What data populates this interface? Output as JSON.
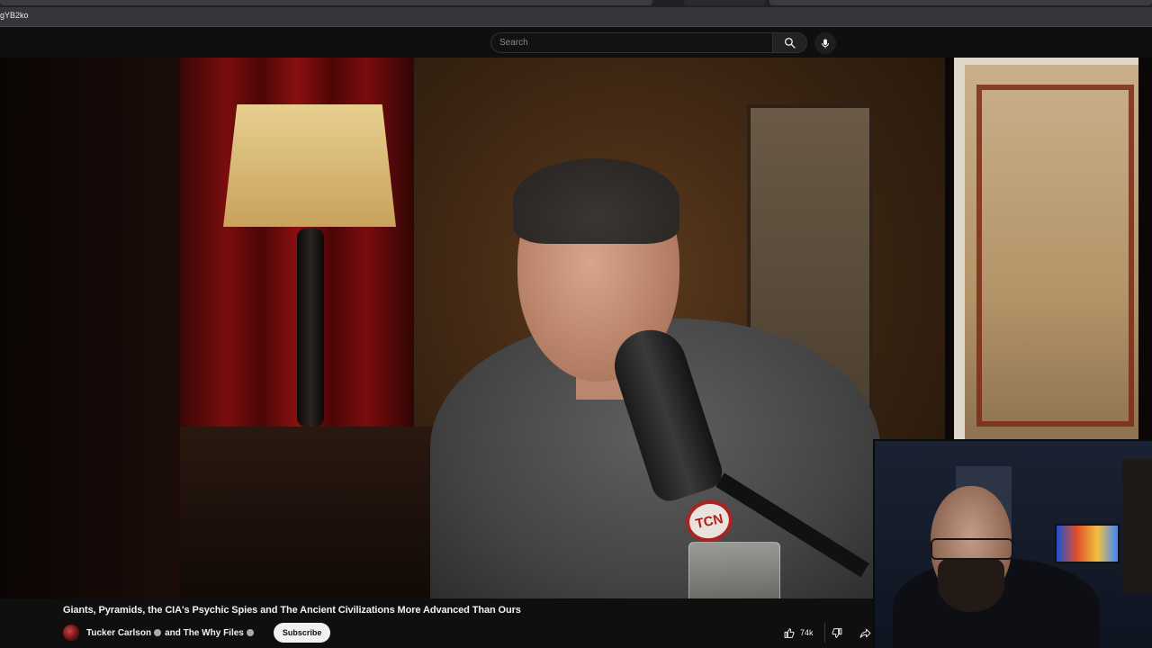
{
  "browser": {
    "url_fragment": "gYB2ko"
  },
  "masthead": {
    "search_placeholder": "Search",
    "search_icon": "search-icon",
    "mic_icon": "microphone-icon"
  },
  "video": {
    "title": "Giants, Pyramids, the CIA's Psychic Spies and The Ancient Civilizations More Advanced Than Ours",
    "mic_logo_text": "TCN"
  },
  "channel": {
    "name_primary": "Tucker Carlson",
    "name_joiner": "and The Why Files",
    "subscribe_label": "Subscribe"
  },
  "actions": {
    "like_count": "74k",
    "like_icon": "thumbs-up-icon",
    "dislike_icon": "thumbs-down-icon",
    "share_icon": "share-icon"
  },
  "colors": {
    "background": "#0f0f0f",
    "text": "#f1f1f1",
    "subscribe_bg": "#f1f1f1"
  }
}
